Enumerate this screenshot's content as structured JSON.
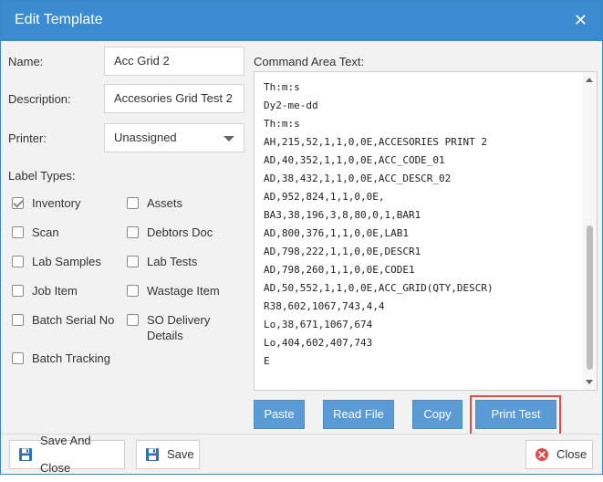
{
  "dialog": {
    "title": "Edit Template",
    "close_glyph": "✕"
  },
  "form": {
    "name_label": "Name:",
    "name_value": "Acc Grid 2",
    "description_label": "Description:",
    "description_value": "Accesories Grid Test 2",
    "printer_label": "Printer:",
    "printer_value": "Unassigned",
    "label_types_label": "Label Types:"
  },
  "label_types": [
    {
      "label": "Inventory",
      "checked": true
    },
    {
      "label": "Assets",
      "checked": false
    },
    {
      "label": "Scan",
      "checked": false
    },
    {
      "label": "Debtors Doc",
      "checked": false
    },
    {
      "label": "Lab Samples",
      "checked": false
    },
    {
      "label": "Lab Tests",
      "checked": false
    },
    {
      "label": "Job Item",
      "checked": false
    },
    {
      "label": "Wastage Item",
      "checked": false
    },
    {
      "label": "Batch Serial No",
      "checked": false
    },
    {
      "label": "SO Delivery\nDetails",
      "checked": false
    },
    {
      "label": "Batch Tracking",
      "checked": false
    }
  ],
  "command_area": {
    "label": "Command Area Text:",
    "lines": [
      "Th:m:s",
      "Dy2-me-dd",
      "Th:m:s",
      "AH,215,52,1,1,0,0E,ACCESORIES PRINT 2",
      "AD,40,352,1,1,0,0E,ACC_CODE_01",
      "AD,38,432,1,1,0,0E,ACC_DESCR_02",
      "AD,952,824,1,1,0,0E,",
      "BA3,38,196,3,8,80,0,1,BAR1",
      "AD,800,376,1,1,0,0E,LAB1",
      "AD,798,222,1,1,0,0E,DESCR1",
      "AD,798,260,1,1,0,0E,CODE1",
      "AD,50,552,1,1,0,0E,ACC_GRID(QTY,DESCR)",
      "R38,602,1067,743,4,4",
      "Lo,38,671,1067,674",
      "Lo,404,602,407,743",
      "E"
    ]
  },
  "actions": {
    "paste": "Paste",
    "read_file": "Read File",
    "copy": "Copy",
    "print_test": "Print Test"
  },
  "footer": {
    "save_and_close": "Save And Close",
    "save": "Save",
    "close": "Close"
  },
  "colors": {
    "titlebar": "#3a8bd0",
    "button_blue": "#5b9bd5",
    "highlight": "#e34a4a",
    "close_icon": "#e04b4b",
    "save_icon": "#2f6fb3"
  }
}
